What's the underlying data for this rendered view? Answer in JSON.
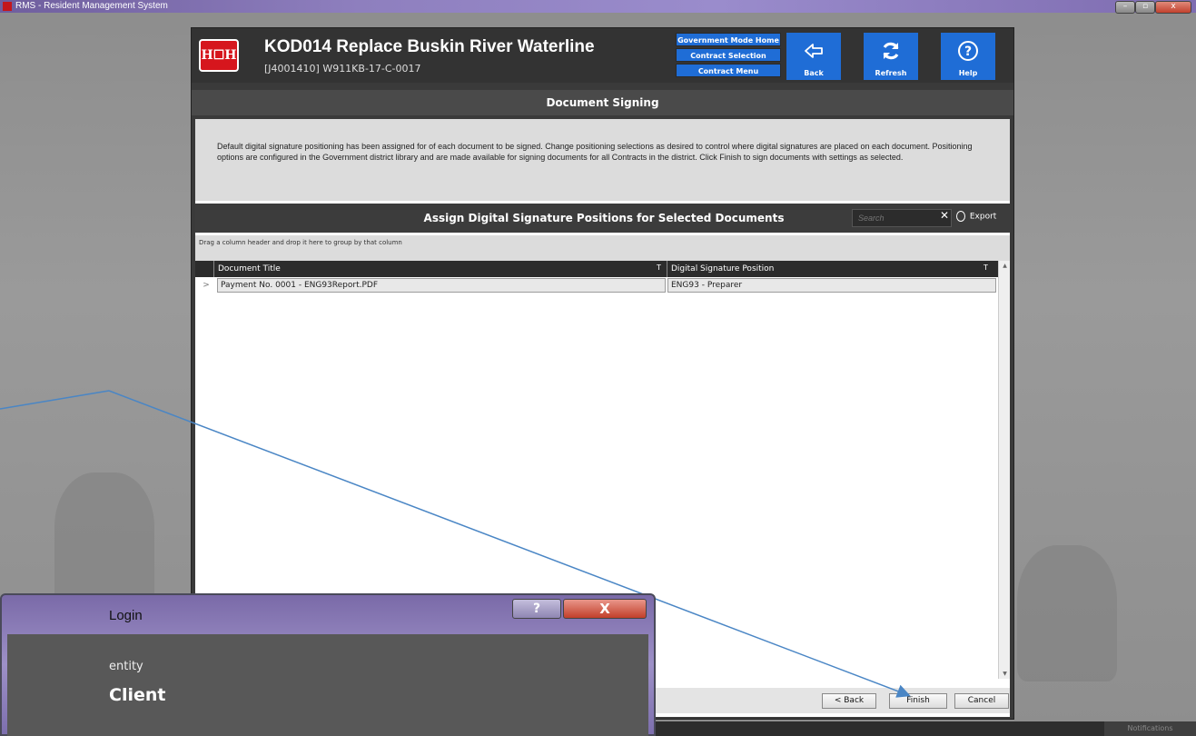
{
  "window": {
    "title": "RMS - Resident Management System",
    "min_glyph": "–",
    "max_glyph": "▫",
    "close_glyph": "x"
  },
  "header": {
    "logo_text": "H☐H",
    "title": "KOD014 Replace Buskin River Waterline",
    "subtitle": "[J4001410] W911KB-17-C-0017",
    "nav_links": [
      "Government Mode Home",
      "Contract Selection",
      "Contract Menu"
    ],
    "nav_buttons": [
      {
        "label": "Back",
        "icon": "back-arrow-icon"
      },
      {
        "label": "Refresh",
        "icon": "refresh-icon"
      },
      {
        "label": "Help",
        "icon": "help-icon"
      }
    ]
  },
  "section": {
    "title": "Document Signing"
  },
  "intro": {
    "text": "Default digital signature positioning has been assigned for of each document to be signed. Change positioning selections as desired to control where digital signatures are placed on each document. Positioning options are configured in the Government district library and are made available for signing documents for all Contracts in the district. Click Finish to sign documents with settings as selected."
  },
  "grid": {
    "title": "Assign Digital Signature Positions for Selected Documents",
    "search_placeholder": "Search",
    "clear_glyph": "✕",
    "export_label": "Export",
    "group_hint": "Drag a column header and drop it here to group by that column",
    "columns": [
      "Document Title",
      "Digital Signature Position"
    ],
    "filter_glyph": "T",
    "rows": [
      {
        "indicator": ">",
        "document_title": "Payment No. 0001 - ENG93Report.PDF",
        "signature_position": "ENG93 - Preparer"
      }
    ]
  },
  "footer": {
    "back_label": "< Back",
    "finish_label": "Finish",
    "cancel_label": "Cancel"
  },
  "login_dialog": {
    "title": "Login",
    "help_glyph": "?",
    "close_glyph": "X",
    "line1": "entity",
    "line2": "Client"
  },
  "taskbar": {
    "notifications_label": "Notifications"
  },
  "colors": {
    "accent_blue": "#1f6dd6",
    "usace_red": "#d6161d",
    "title_bar_purple": "#8e7fbe"
  }
}
